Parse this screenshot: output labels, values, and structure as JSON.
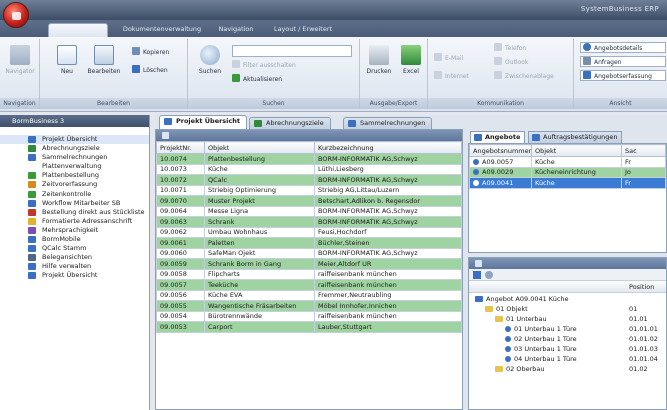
{
  "app": {
    "title": "SystemBusiness ERP"
  },
  "ribbon": {
    "tabs": [
      {
        "label": "",
        "active": true
      },
      {
        "label": "Dokumentenverwaltung"
      },
      {
        "label": "Navigation"
      },
      {
        "label": "Layout / Erweitert"
      }
    ],
    "groups": {
      "navigation": {
        "label": "Navigation",
        "btn": "Navigator"
      },
      "bearbeiten": {
        "label": "Bearbeiten",
        "neu": "Neu",
        "bearbeiten": "Bearbeiten",
        "kopieren": "Kopieren",
        "loeschen": "Löschen"
      },
      "suchen": {
        "label": "Suchen",
        "suchen": "Suchen",
        "filter": "Filter ausschalten",
        "aktualisieren": "Aktualisieren"
      },
      "ausgabe": {
        "label": "Ausgabe/Export",
        "drucken": "Drucken",
        "excel": "Excel"
      },
      "kommunikation": {
        "label": "Kommunikation",
        "email": "E-Mail",
        "internet": "Internet",
        "telefon": "Telefon",
        "outlook": "Outlook",
        "zwischenablage": "Zwischenablage"
      },
      "ansicht": {
        "label": "Ansicht",
        "items": [
          "Angebotsdetails",
          "Anfragen",
          "Angebotserfassung"
        ]
      }
    }
  },
  "sidebar": {
    "title": "BormBusiness 3",
    "items": [
      {
        "label": "Projekt Übersicht",
        "icon": "project-icon",
        "color": "#3b6fc4"
      },
      {
        "label": "Abrechnungsziele",
        "icon": "target-icon",
        "color": "#2f8a3a"
      },
      {
        "label": "Sammelrechnungen",
        "icon": "invoice-icon",
        "color": "#3b6fc4"
      },
      {
        "label": "Plattenverwaltung",
        "icon": "",
        "color": ""
      },
      {
        "label": "Plattenbestellung",
        "icon": "check-icon",
        "color": "#3a9a3a"
      },
      {
        "label": "Zeitvorerfassung",
        "icon": "clock-icon",
        "color": "#d38a1e"
      },
      {
        "label": "Zeitenkontrolle",
        "icon": "check-icon",
        "color": "#3a9a3a"
      },
      {
        "label": "Workflow Mitarbeiter SB",
        "icon": "workflow-icon",
        "color": "#3b6fc4"
      },
      {
        "label": "Bestellung direkt aus Stückliste",
        "icon": "order-icon",
        "color": "#c0392b"
      },
      {
        "label": "Formatierte Adressanschrift",
        "icon": "address-icon",
        "color": "#e0b22f"
      },
      {
        "label": "Mehrsprachigkeit",
        "icon": "language-icon",
        "color": "#7a4fb0"
      },
      {
        "label": "BormMobile",
        "icon": "mobile-icon",
        "color": "#3b6fc4"
      },
      {
        "label": "QCalc Stamm",
        "icon": "calc-icon",
        "color": "#3b6fc4"
      },
      {
        "label": "Belegansichten",
        "icon": "document-icon",
        "color": "#4f6786"
      },
      {
        "label": "Hilfe verwalten",
        "icon": "help-icon",
        "color": "#3b6fc4"
      },
      {
        "label": "Projekt Übersicht",
        "icon": "project-icon",
        "color": "#3b6fc4"
      }
    ]
  },
  "doc_tabs": [
    {
      "label": "Projekt Übersicht",
      "active": true
    },
    {
      "label": "Abrechnungsziele"
    },
    {
      "label": "Sammelrechnungen"
    }
  ],
  "projects": {
    "columns": [
      "ProjektNr.",
      "Objekt",
      "Kurzbezeichnung"
    ],
    "rows": [
      [
        "10.0074",
        "Plattenbestellung",
        "BORM-INFORMATIK AG,Schwyz",
        "g"
      ],
      [
        "10.0073",
        "Küche",
        "Lüthi,Liesberg",
        "w"
      ],
      [
        "10.0072",
        "QCalc",
        "BORM-INFORMATIK AG,Schwyz",
        "g"
      ],
      [
        "10.0071",
        "Striebig Optimierung",
        "Striebig AG,Littau/Luzern",
        "w"
      ],
      [
        "09.0070",
        "Muster Projekt",
        "Betschart,Adlikon b. Regensdor",
        "g"
      ],
      [
        "09.0064",
        "Messe Ligna",
        "BORM-INFORMATIK AG,Schwyz",
        "w"
      ],
      [
        "09.0063",
        "Schrank",
        "BORM-INFORMATIK AG,Schwyz",
        "g"
      ],
      [
        "09.0062",
        "Umbau Wohnhaus",
        "Feusi,Hochdorf",
        "w"
      ],
      [
        "09.0061",
        "Paletten",
        "Büchler,Steinen",
        "g"
      ],
      [
        "09.0060",
        "SafeMan Ojekt",
        "BORM-INFORMATIK AG,Schwyz",
        "w"
      ],
      [
        "09.0059",
        "Schrank Borm in Gang",
        "Meier,Altdorf UR",
        "g"
      ],
      [
        "09.0058",
        "Flipcharts",
        "raiffeisenbank münchen",
        "w"
      ],
      [
        "09.0057",
        "Teeküche",
        "raiffeisenbank münchen",
        "g"
      ],
      [
        "09.0056",
        "Küche EVA",
        "Fremmer,Neutraubling",
        "w"
      ],
      [
        "09.0055",
        "Wangentische Fräsarbeiten",
        "Möbel Innhofer,Innichen",
        "g"
      ],
      [
        "09.0054",
        "Bürotrennwände",
        "raiffeisenbank münchen",
        "w"
      ],
      [
        "09.0053",
        "Carport",
        "Lauber,Stuttgart",
        "g"
      ]
    ]
  },
  "sub_tabs": [
    {
      "label": "Angebote",
      "active": true
    },
    {
      "label": "Auftragsbestätigungen"
    }
  ],
  "offers": {
    "columns": [
      "Angebotsnummer",
      "Objekt",
      "Sac"
    ],
    "rows": [
      [
        "A09.0057",
        "Küche",
        "Fr",
        "w"
      ],
      [
        "A09.0029",
        "Kücheneinrichtung",
        "Jo",
        "g"
      ],
      [
        "A09.0041",
        "Küche",
        "Fr",
        "b"
      ]
    ]
  },
  "tree": {
    "position_header": "Position",
    "rows": [
      {
        "label": "Angebot A09.0041 Küche",
        "pos": "",
        "depth": 0,
        "kind": "root"
      },
      {
        "label": "01 Objekt",
        "pos": "01",
        "depth": 1,
        "kind": "folder"
      },
      {
        "label": "01 Unterbau",
        "pos": "01.01",
        "depth": 2,
        "kind": "folder"
      },
      {
        "label": "01 Unterbau 1 Türe",
        "pos": "01.01.01",
        "depth": 3,
        "kind": "item"
      },
      {
        "label": "02 Unterbau 1 Türe",
        "pos": "01.01.02",
        "depth": 3,
        "kind": "item"
      },
      {
        "label": "03 Unterbau 1 Türe",
        "pos": "01.01.03",
        "depth": 3,
        "kind": "item"
      },
      {
        "label": "04 Unterbau 1 Türe",
        "pos": "01.01.04",
        "depth": 3,
        "kind": "item"
      },
      {
        "label": "02 Oberbau",
        "pos": "01.02",
        "depth": 2,
        "kind": "folder"
      }
    ]
  }
}
